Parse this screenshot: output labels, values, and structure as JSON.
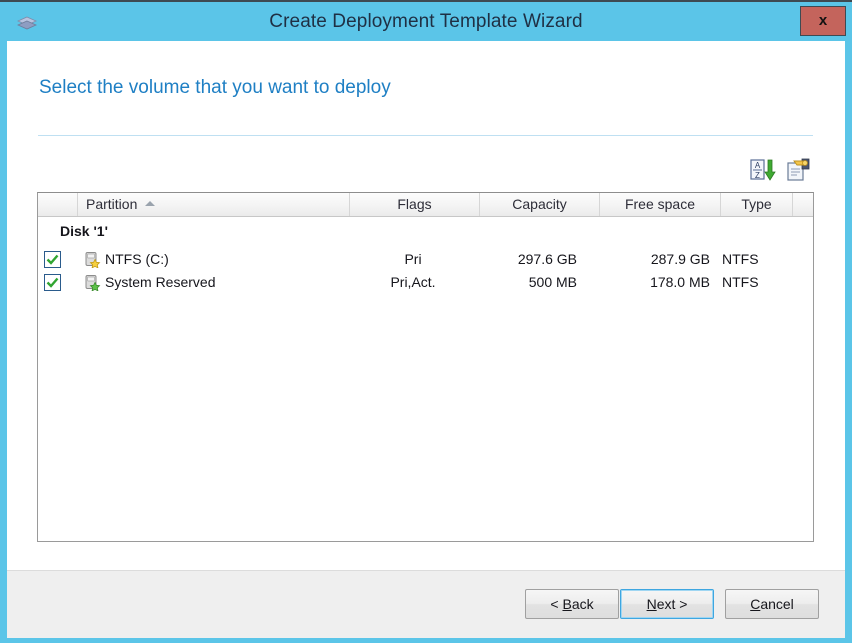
{
  "window": {
    "title": "Create Deployment Template Wizard",
    "icon": "wizard-diamond-icon",
    "close_label": "x",
    "accent_color": "#5bc5e8",
    "close_color": "#c4645c"
  },
  "page": {
    "heading": "Select the volume that you want to deploy",
    "heading_color": "#1e7fc4"
  },
  "toolbar": {
    "items": [
      {
        "name": "sort-az-descending-icon",
        "tooltip": "Sort"
      },
      {
        "name": "properties-icon",
        "tooltip": "Properties"
      }
    ]
  },
  "list": {
    "columns": [
      {
        "key": "check",
        "label": ""
      },
      {
        "key": "name",
        "label": "Partition",
        "sort": "asc"
      },
      {
        "key": "flags",
        "label": "Flags"
      },
      {
        "key": "cap",
        "label": "Capacity"
      },
      {
        "key": "free",
        "label": "Free space"
      },
      {
        "key": "type",
        "label": "Type"
      },
      {
        "key": "spacer",
        "label": ""
      }
    ],
    "group_label": "Disk '1'",
    "rows": [
      {
        "checked": true,
        "icon": "drive-star-gold-icon",
        "name": "NTFS (C:)",
        "flags": "Pri",
        "capacity": "297.6 GB",
        "free_space": "287.9 GB",
        "type": "NTFS"
      },
      {
        "checked": true,
        "icon": "drive-star-green-icon",
        "name": "System Reserved",
        "flags": "Pri,Act.",
        "capacity": "500 MB",
        "free_space": "178.0 MB",
        "type": "NTFS"
      }
    ]
  },
  "footer": {
    "back": {
      "pre": "< ",
      "mnemonic": "B",
      "post": "ack"
    },
    "next": {
      "pre": "",
      "mnemonic": "N",
      "post": "ext >"
    },
    "cancel": {
      "pre": "",
      "mnemonic": "C",
      "post": "ancel"
    }
  }
}
